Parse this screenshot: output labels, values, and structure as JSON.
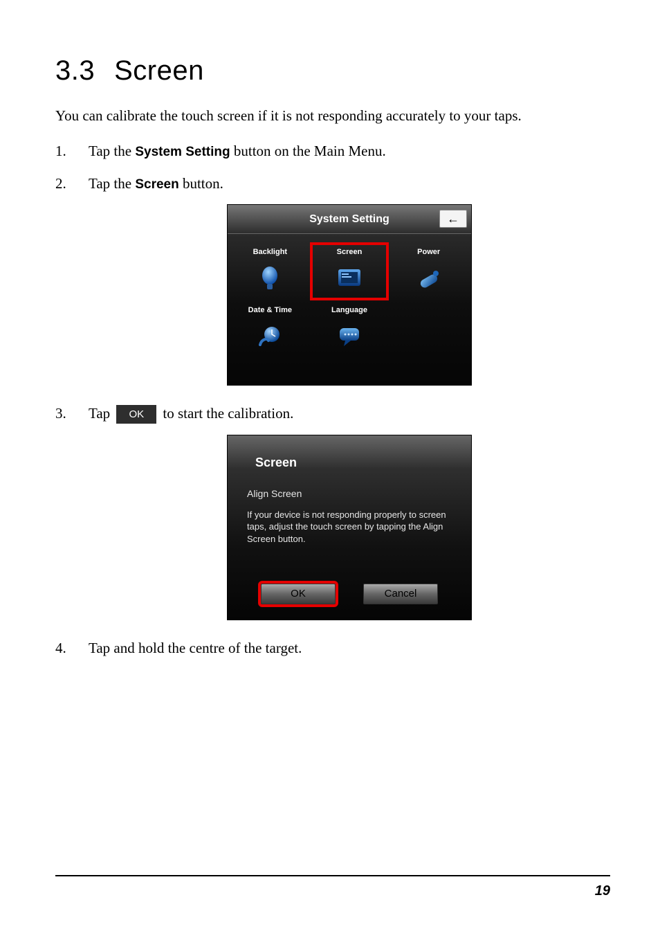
{
  "section": {
    "number": "3.3",
    "title": "Screen"
  },
  "intro": "You can calibrate the touch screen if it is not responding accurately to your taps.",
  "steps": {
    "s1_pre": "Tap the ",
    "s1_bold": "System Setting",
    "s1_post": " button on the Main Menu.",
    "s2_pre": "Tap the ",
    "s2_bold": "Screen",
    "s2_post": " button.",
    "s3_pre": "Tap ",
    "s3_btn": "OK",
    "s3_post": " to start the calibration.",
    "s4": "Tap and hold the centre of the target."
  },
  "sys_shot": {
    "title": "System Setting",
    "back_glyph": "←",
    "items": {
      "backlight": "Backlight",
      "screen": "Screen",
      "power": "Power",
      "datetime": "Date & Time",
      "language": "Language"
    }
  },
  "dlg_shot": {
    "title": "Screen",
    "subtitle": "Align Screen",
    "desc": "If your device is not responding properly to screen taps, adjust the touch screen by tapping the Align Screen button.",
    "ok": "OK",
    "cancel": "Cancel"
  },
  "page_number": "19"
}
